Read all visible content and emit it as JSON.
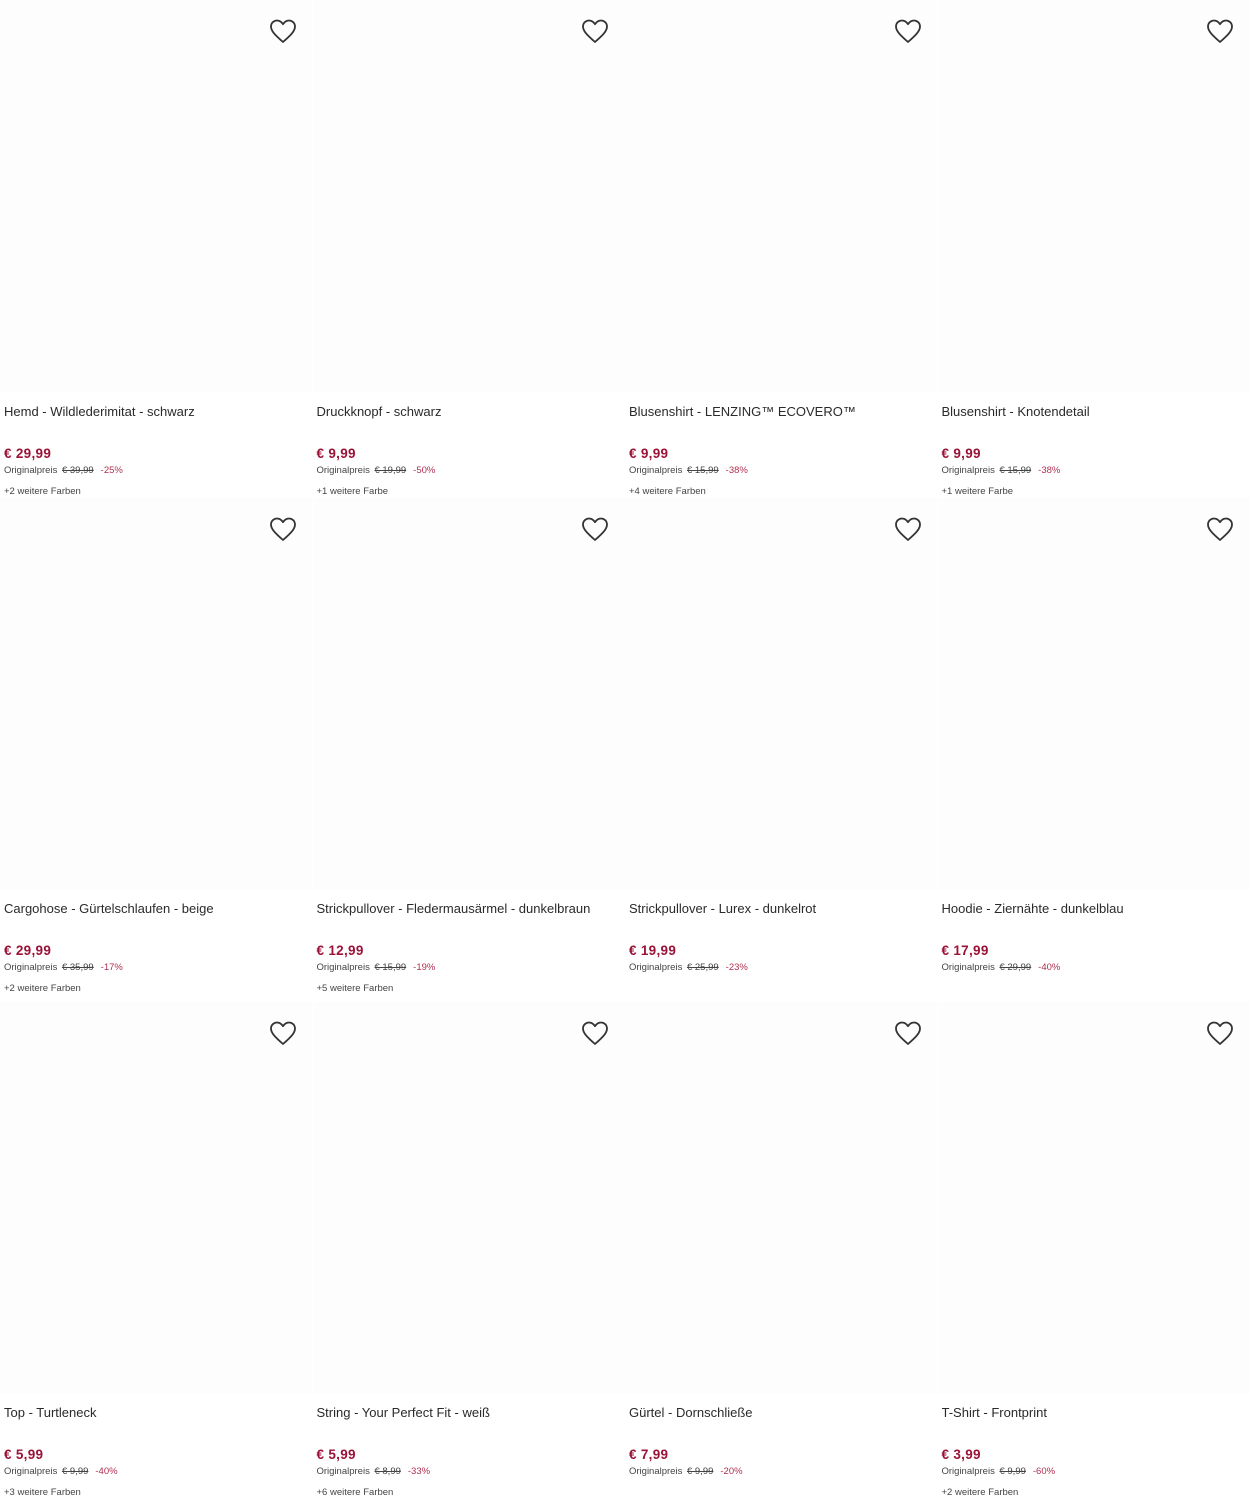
{
  "icons": {
    "wishlist": "heart-outline-icon"
  },
  "colors": {
    "price": "#9b1238",
    "discount": "#b03050",
    "text": "#2a2a2a"
  },
  "products": [
    {
      "title": "Hemd - Wildlederimitat - schwarz",
      "price": "€ 29,99",
      "orig_label": "Originalpreis",
      "orig_price": "€ 39,99",
      "discount": "-25%",
      "colors": "+2 weitere Farben"
    },
    {
      "title": "Druckknopf - schwarz",
      "price": "€ 9,99",
      "orig_label": "Originalpreis",
      "orig_price": "€ 19,99",
      "discount": "-50%",
      "colors": "+1 weitere Farbe"
    },
    {
      "title": "Blusenshirt - LENZING™ ECOVERO™",
      "price": "€ 9,99",
      "orig_label": "Originalpreis",
      "orig_price": "€ 15,99",
      "discount": "-38%",
      "colors": "+4 weitere Farben"
    },
    {
      "title": "Blusenshirt - Knotendetail",
      "price": "€ 9,99",
      "orig_label": "Originalpreis",
      "orig_price": "€ 15,99",
      "discount": "-38%",
      "colors": "+1 weitere Farbe"
    },
    {
      "title": "Cargohose - Gürtelschlaufen - beige",
      "price": "€ 29,99",
      "orig_label": "Originalpreis",
      "orig_price": "€ 35,99",
      "discount": "-17%",
      "colors": "+2 weitere Farben"
    },
    {
      "title": "Strickpullover - Fledermausärmel - dunkelbraun",
      "price": "€ 12,99",
      "orig_label": "Originalpreis",
      "orig_price": "€ 15,99",
      "discount": "-19%",
      "colors": "+5 weitere Farben"
    },
    {
      "title": "Strickpullover - Lurex - dunkelrot",
      "price": "€ 19,99",
      "orig_label": "Originalpreis",
      "orig_price": "€ 25,99",
      "discount": "-23%",
      "colors": ""
    },
    {
      "title": "Hoodie - Ziernähte - dunkelblau",
      "price": "€ 17,99",
      "orig_label": "Originalpreis",
      "orig_price": "€ 29,99",
      "discount": "-40%",
      "colors": ""
    },
    {
      "title": "Top - Turtleneck",
      "price": "€ 5,99",
      "orig_label": "Originalpreis",
      "orig_price": "€ 9,99",
      "discount": "-40%",
      "colors": "+3 weitere Farben"
    },
    {
      "title": "String - Your Perfect Fit - weiß",
      "price": "€ 5,99",
      "orig_label": "Originalpreis",
      "orig_price": "€ 8,99",
      "discount": "-33%",
      "colors": "+6 weitere Farben"
    },
    {
      "title": "Gürtel - Dornschließe",
      "price": "€ 7,99",
      "orig_label": "Originalpreis",
      "orig_price": "€ 9,99",
      "discount": "-20%",
      "colors": ""
    },
    {
      "title": "T-Shirt - Frontprint",
      "price": "€ 3,99",
      "orig_label": "Originalpreis",
      "orig_price": "€ 9,99",
      "discount": "-60%",
      "colors": "+2 weitere Farben"
    }
  ]
}
